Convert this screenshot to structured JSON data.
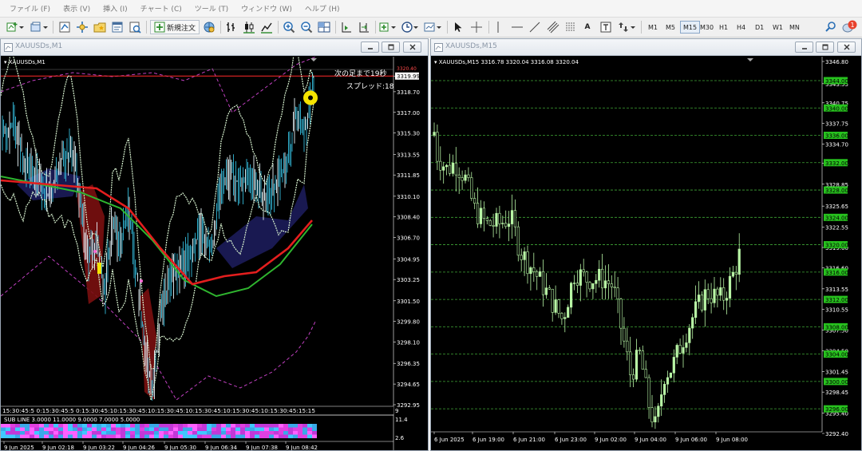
{
  "menu": [
    "ファイル (F)",
    "表示 (V)",
    "挿入 (I)",
    "チャート (C)",
    "ツール (T)",
    "ウィンドウ (W)",
    "ヘルプ (H)"
  ],
  "toolbar": {
    "new_order_label": "新規注文",
    "timeframes": [
      "M1",
      "M5",
      "M15",
      "M30",
      "H1",
      "H4",
      "D1",
      "W1",
      "MN"
    ],
    "active_timeframe": "M15",
    "notification_count": "1",
    "text_tool_label": "A"
  },
  "left_chart": {
    "window_title": "XAUUSDs,M1",
    "header": "▾ XAUUSDs,M1",
    "countdown_text": "次の足まで19秒",
    "spread_text": "スプレッド:18",
    "price_ticks": [
      "3319.99",
      "3318.70",
      "3317.00",
      "3315.30",
      "3313.55",
      "3311.85",
      "3310.10",
      "3308.40",
      "3306.70",
      "3304.95",
      "3303.25",
      "3301.50",
      "3299.80",
      "3298.10",
      "3296.35",
      "3294.65",
      "3292.95"
    ],
    "current_price_label": "3319.99",
    "top_clipped_label": "3320.40",
    "time_ticks": [
      "9 Jun 2025",
      "9 Jun 02:18",
      "9 Jun 03:22",
      "9 Jun 04:26",
      "9 Jun 05:30",
      "9 Jun 06:34",
      "9 Jun 07:38",
      "9 Jun 08:42"
    ],
    "session_strip_text": "15:30:45:5 0:15:30:45:5 0:15:30:45:10:15:30:45:10:15:30:45:10:15:30:45:10:15:30:45:10:15:30:45:15:15",
    "sub_indicator_label": "SUB LINE 3.0000 11.0000 9.0000 7.0000 5.0000",
    "sub_scale_top": "11.4",
    "sub_scale_bottom": "2.6",
    "sub_top_mark": "9"
  },
  "right_chart": {
    "window_title": "XAUUSDs,M15",
    "header": "▾ XAUUSDs,M15  3316.78 3320.04 3316.08 3320.04",
    "price_ticks": [
      "3346.80",
      "3343.55",
      "3340.75",
      "3337.75",
      "3334.70",
      "3331.90",
      "3328.85",
      "3325.65",
      "3322.55",
      "3319.60",
      "3316.60",
      "3313.55",
      "3310.55",
      "3307.50",
      "3304.50",
      "3301.45",
      "3298.45",
      "3295.40",
      "3292.40"
    ],
    "grid_labels": [
      "3344.00",
      "3340.00",
      "3336.00",
      "3332.00",
      "3328.00",
      "3324.00",
      "3320.00",
      "3316.00",
      "3312.00",
      "3308.00",
      "3304.00",
      "3300.00",
      "3296.00"
    ],
    "time_ticks": [
      "6 Jun 2025",
      "6 Jun 19:00",
      "6 Jun 21:00",
      "6 Jun 23:00",
      "9 Jun 02:00",
      "9 Jun 04:00",
      "9 Jun 06:00",
      "9 Jun 08:00"
    ]
  },
  "colors": {
    "chart_bg": "#000000",
    "grid_green": "#3fa636",
    "grid_label_bg": "#27c21e",
    "candle_green": "#b8f5a5",
    "ma_red": "#e31e1e",
    "ma_green": "#2fb52f",
    "band_magenta": "#c040c0",
    "price_line_red": "#ff2b2b",
    "cyan": "#33b8d8",
    "highlight_yellow": "#f5e400"
  }
}
